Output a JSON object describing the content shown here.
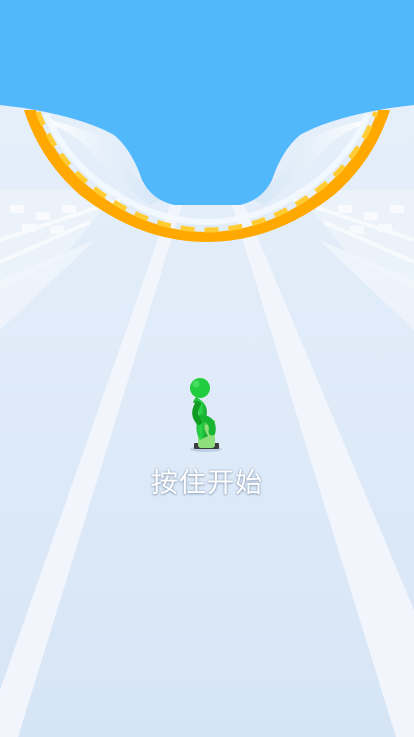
{
  "game": {
    "start_prompt": "按住开始"
  },
  "colors": {
    "sky": "#51b8fb",
    "track": "#d9e7f7",
    "track_stripe": "#f2f6fc",
    "ramp_orange": "#ffa900",
    "ramp_yellow": "#ffcc33",
    "ramp_glass": "#e9f3fc",
    "player_body": "#1fc63a",
    "skateboard": "#8fe07d",
    "wheels": "#3d3d3d"
  },
  "icons": {
    "player": "stickman-runner-icon",
    "board": "skateboard-icon"
  }
}
